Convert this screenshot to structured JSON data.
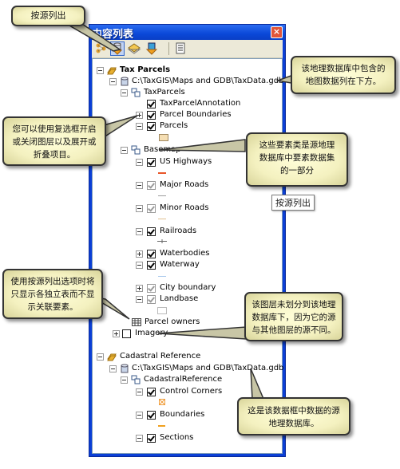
{
  "window": {
    "title": "内容列表",
    "close_label": "×",
    "toolbar": [
      {
        "name": "list-by-drawing-order",
        "icon": "drawing-order-icon",
        "active": false
      },
      {
        "name": "list-by-source",
        "icon": "database-source-icon",
        "active": true
      },
      {
        "name": "list-by-visibility",
        "icon": "layers-visibility-icon",
        "active": false
      },
      {
        "name": "list-by-selection",
        "icon": "selection-icon",
        "active": false
      },
      {
        "name": "options",
        "icon": "options-list-icon",
        "active": false
      }
    ]
  },
  "tree": {
    "tax_parcels": "Tax Parcels",
    "gdb1": "C:\\TaxGIS\\Maps and GDB\\TaxData.gdb",
    "taxparcels_ds": "TaxParcels",
    "tax_parcel_annotation": "TaxParcelAnnotation",
    "parcel_boundaries": "Parcel Boundaries",
    "parcels": "Parcels",
    "basemap": "Basemap",
    "us_highways": "US Highways",
    "major_roads": "Major Roads",
    "minor_roads": "Minor Roads",
    "railroads": "Railroads",
    "waterbodies": "Waterbodies",
    "waterway": "Waterway",
    "city_boundary": "City boundary",
    "landbase": "Landbase",
    "parcel_owners": "Parcel owners",
    "imagery": "Imagery",
    "cadastral_reference": "Cadastral Reference",
    "gdb2": "C:\\TaxGIS\\Maps and GDB\\TaxData.gdb",
    "cadastral_ds": "CadastralReference",
    "control_corners": "Control Corners",
    "boundaries": "Boundaries",
    "sections": "Sections"
  },
  "symbol_colors": {
    "parcels": "#f5deb3",
    "us_highways": "#e8562a",
    "major_roads": "#9e9e9e",
    "minor_roads": "#e0c090",
    "railroads": "#666666",
    "waterway": "#a8c8ec",
    "landbase": "#ffffff",
    "control_corners": "#f0a040",
    "boundaries": "#f0a020"
  },
  "callouts": {
    "list_by_source": "按源列出",
    "gdb_contents": "该地理数据库中包含的地图数据列在下方。",
    "checkboxes": "您可以使用复选框开启或关闭图层以及展开或折叠项目。",
    "feature_classes": "这些要素类是源地理数据库中要素数据集的一部分",
    "standalone_tables": "使用按源列出选项时将只显示各独立表而不显示关联要素。",
    "imagery_source": "该图层未划分到该地理数据库下，因为它的源与其他图层的源不同。",
    "frame_source": "这是该数据框中数据的源地理数据库。"
  },
  "tooltip": "按源列出"
}
